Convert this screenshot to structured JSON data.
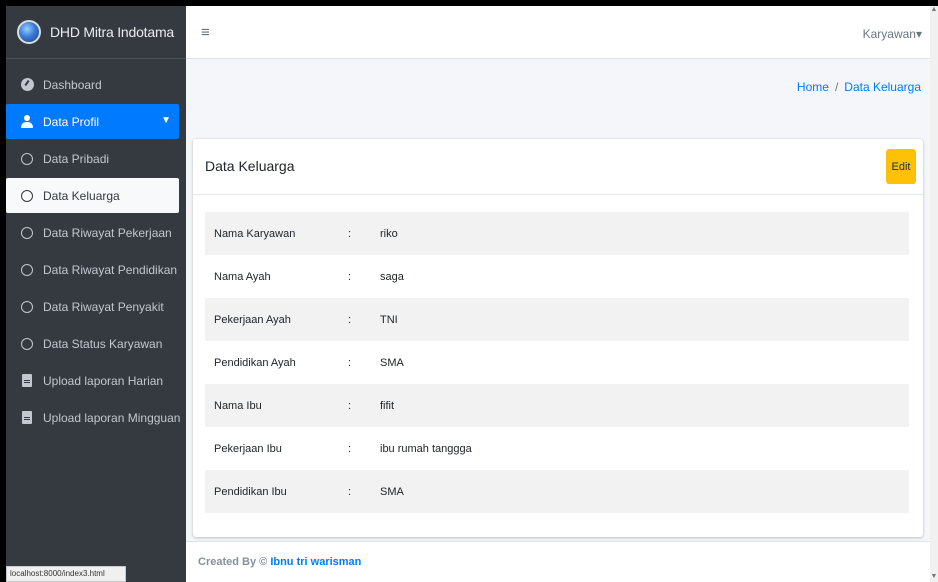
{
  "sidebar": {
    "brand": "DHD Mitra Indotama",
    "items": [
      {
        "label": "Dashboard",
        "icon": "dashboard-icon"
      },
      {
        "label": "Data Profil",
        "icon": "user-icon"
      },
      {
        "label": "Data Pribadi",
        "icon": "circle-icon"
      },
      {
        "label": "Data Keluarga",
        "icon": "circle-icon"
      },
      {
        "label": "Data Riwayat Pekerjaan",
        "icon": "circle-icon"
      },
      {
        "label": "Data Riwayat Pendidikan",
        "icon": "circle-icon"
      },
      {
        "label": "Data Riwayat Penyakit",
        "icon": "circle-icon"
      },
      {
        "label": "Data Status Karyawan",
        "icon": "circle-icon"
      },
      {
        "label": "Upload laporan Harian",
        "icon": "document-icon"
      },
      {
        "label": "Upload laporan Mingguan",
        "icon": "document-icon"
      }
    ]
  },
  "status_bar": {
    "url": "localhost:8000/index3.html"
  },
  "header": {
    "hamburger": "≡",
    "user": "Karyawan",
    "user_chevron": "▾"
  },
  "breadcrumb": {
    "home": "Home",
    "separator": "/",
    "current": "Data Keluarga"
  },
  "card": {
    "title": "Data Keluarga",
    "edit_label": "Edit",
    "rows": [
      {
        "label": "Nama Karyawan",
        "colon": ":",
        "value": "riko"
      },
      {
        "label": "Nama Ayah",
        "colon": ":",
        "value": "saga"
      },
      {
        "label": "Pekerjaan Ayah",
        "colon": ":",
        "value": "TNI"
      },
      {
        "label": "Pendidikan Ayah",
        "colon": ":",
        "value": "SMA"
      },
      {
        "label": "Nama Ibu",
        "colon": ":",
        "value": "fifit"
      },
      {
        "label": "Pekerjaan Ibu",
        "colon": ":",
        "value": "ibu rumah tanggga"
      },
      {
        "label": "Pendidikan Ibu",
        "colon": ":",
        "value": "SMA"
      }
    ]
  },
  "footer": {
    "prefix": "Created By ©",
    "author": "Ibnu tri warisman"
  },
  "colors": {
    "sidebar": "#343a40",
    "active": "#007bff",
    "edit_button": "#ffc107"
  }
}
